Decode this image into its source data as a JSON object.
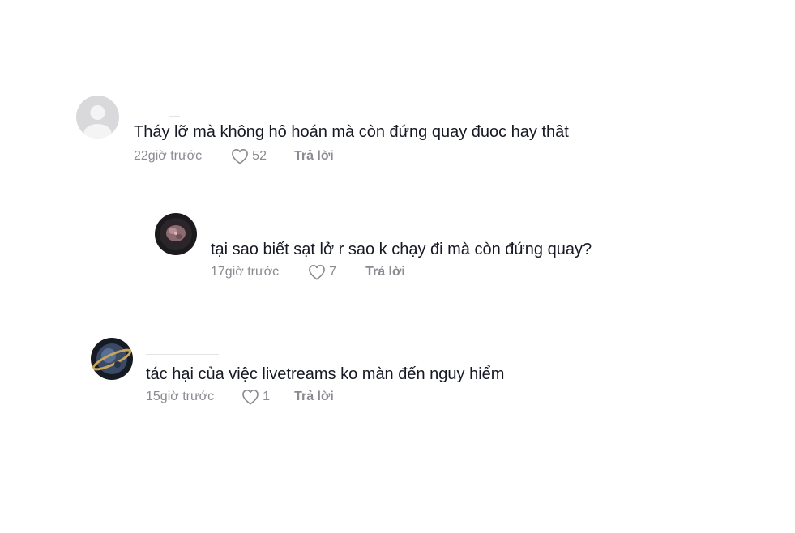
{
  "comments": [
    {
      "text": "Tháy lỡ mà không hô hoán mà còn đứng quay đuoc hay thât",
      "time": "22giờ trước",
      "likes": "52",
      "reply_label": "Trả lời"
    },
    {
      "text": "tại sao biết sạt lở r sao k chạy đi mà còn đứng quay?",
      "time": "17giờ trước",
      "likes": "7",
      "reply_label": "Trả lời"
    },
    {
      "text": "tác hại của việc livetreams ko màn đến nguy hiểm",
      "time": "15giờ trước",
      "likes": "1",
      "reply_label": "Trả lời"
    }
  ],
  "colors": {
    "text": "#161823",
    "meta": "#8a8b91",
    "background": "#ffffff"
  },
  "icons": {
    "like": "heart-outline-icon",
    "default_avatar": "user-placeholder-icon"
  }
}
